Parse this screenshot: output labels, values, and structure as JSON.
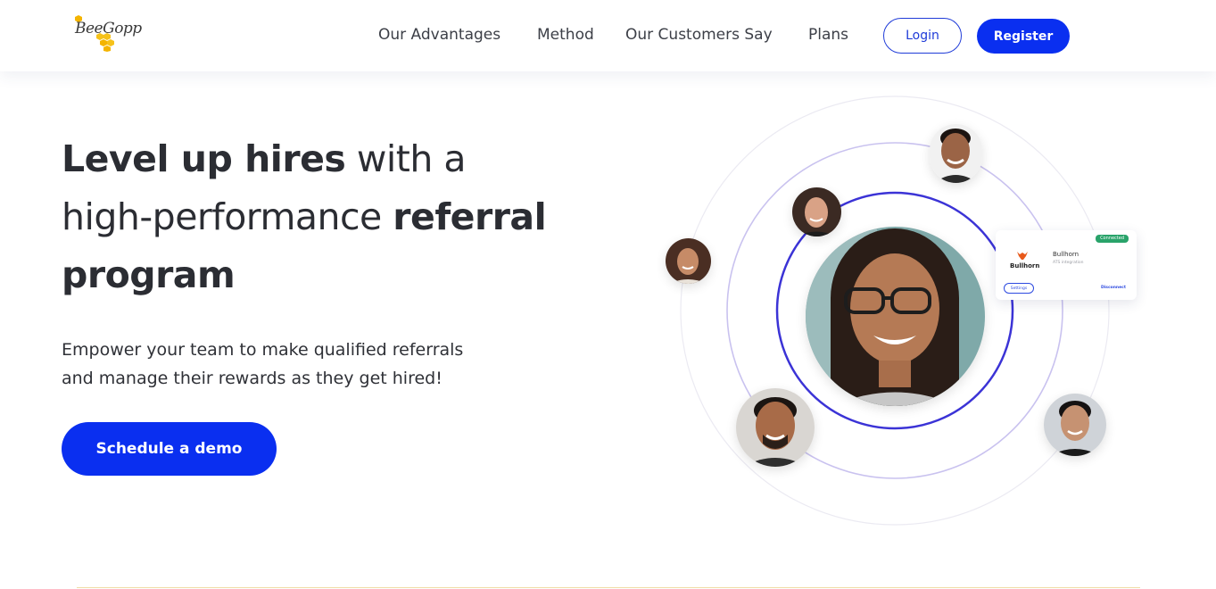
{
  "brand": {
    "name": "BeeGopp"
  },
  "nav": {
    "items": [
      "Our Advantages",
      "Method",
      "Our Customers Say",
      "Plans"
    ],
    "login": "Login",
    "register": "Register"
  },
  "hero": {
    "headline": {
      "bold1": "Level up hires",
      "light1": " with a",
      "light2": "high-performance ",
      "bold2": "referral",
      "bold3": "program"
    },
    "subtext_line1": "Empower your team to make qualified referrals",
    "subtext_line2": "and manage their rewards as they get hired!",
    "cta": "Schedule a demo"
  },
  "integration_card": {
    "badge": "Connected",
    "logo_text": "Bullhorn",
    "title": "Bullhorn",
    "subtitle": "ATS integration",
    "settings": "Settings",
    "disconnect": "Disconnect"
  },
  "colors": {
    "primary": "#0a2ff0",
    "ring": "#3b33d6",
    "ring_light": "#c9c2ef",
    "success": "#29a36a"
  }
}
